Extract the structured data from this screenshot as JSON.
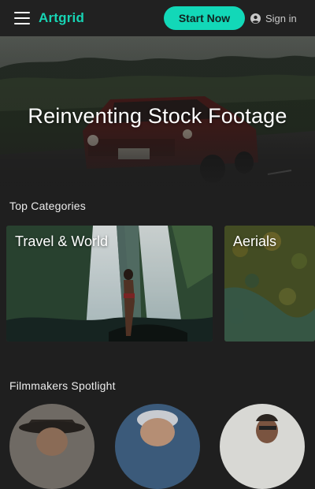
{
  "header": {
    "logo_text": "Artgrid",
    "start_label": "Start Now",
    "signin_label": "Sign in"
  },
  "hero": {
    "title": "Reinventing Stock Footage"
  },
  "top_categories": {
    "title": "Top Categories",
    "cards": [
      {
        "label": "Travel & World"
      },
      {
        "label": "Aerials"
      }
    ]
  },
  "spotlight": {
    "title": "Filmmakers Spotlight"
  },
  "colors": {
    "accent": "#12d8b8",
    "background": "#1f1f1f",
    "header": "#212121"
  },
  "icons": [
    "menu-icon",
    "user-circle-icon"
  ]
}
